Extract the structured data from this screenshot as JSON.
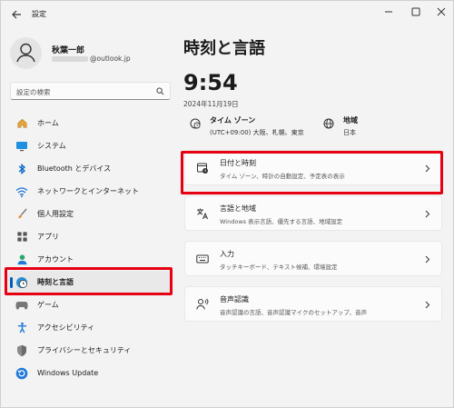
{
  "window": {
    "title": "設定"
  },
  "user": {
    "name": "秋葉一郎",
    "email_domain": "@outlook.jp"
  },
  "search": {
    "placeholder": "設定の検索"
  },
  "sidebar": {
    "items": [
      {
        "label": "ホーム",
        "icon": "home-icon"
      },
      {
        "label": "システム",
        "icon": "monitor-icon"
      },
      {
        "label": "Bluetooth とデバイス",
        "icon": "bluetooth-icon"
      },
      {
        "label": "ネットワークとインターネット",
        "icon": "wifi-icon"
      },
      {
        "label": "個人用設定",
        "icon": "brush-icon"
      },
      {
        "label": "アプリ",
        "icon": "apps-icon"
      },
      {
        "label": "アカウント",
        "icon": "person-icon"
      },
      {
        "label": "時刻と言語",
        "icon": "clock-globe-icon",
        "active": true
      },
      {
        "label": "ゲーム",
        "icon": "gamepad-icon"
      },
      {
        "label": "アクセシビリティ",
        "icon": "accessibility-icon"
      },
      {
        "label": "プライバシーとセキュリティ",
        "icon": "shield-icon"
      },
      {
        "label": "Windows Update",
        "icon": "update-icon"
      }
    ]
  },
  "main": {
    "title": "時刻と言語",
    "time": "9:54",
    "date": "2024年11月19日",
    "timezone": {
      "title": "タイム ゾーン",
      "value": "(UTC+09:00) 大阪、札幌、東京"
    },
    "region": {
      "title": "地域",
      "value": "日本"
    },
    "cards": [
      {
        "title": "日付と時刻",
        "desc": "タイム ゾーン、時計の自動設定、予定表の表示",
        "icon": "calendar-clock-icon"
      },
      {
        "title": "言語と地域",
        "desc": "Windows 表示言語、優先する言語、地域設定",
        "icon": "language-icon"
      },
      {
        "title": "入力",
        "desc": "タッチキーボード、テキスト候補、環境設定",
        "icon": "keyboard-icon"
      },
      {
        "title": "音声認識",
        "desc": "音声認識の言語、音声認識マイクのセットアップ、音声",
        "icon": "speech-icon"
      }
    ]
  },
  "colors": {
    "accent": "#005fb8",
    "highlight": "#e60012"
  }
}
